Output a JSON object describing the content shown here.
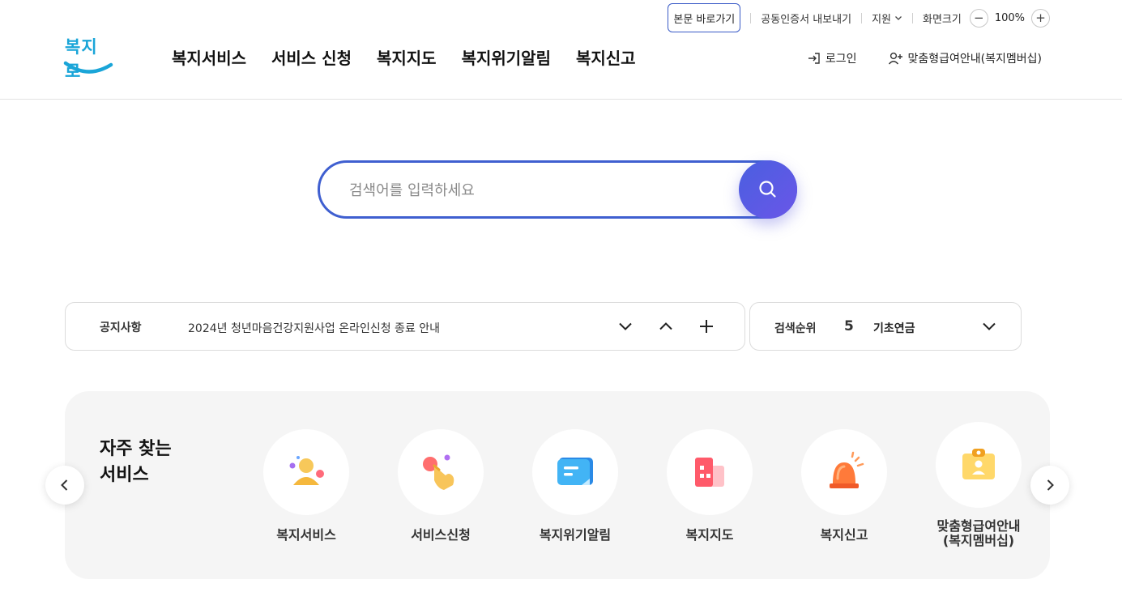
{
  "util": {
    "skip_link": "본문 바로가기",
    "cert_export": "공동인증서 내보내기",
    "support": "지원",
    "zoom_label": "화면크기",
    "zoom_minus": "−",
    "zoom_value": "100%",
    "zoom_plus": "+"
  },
  "logo": {
    "text": "복지로"
  },
  "gnb": {
    "items": [
      {
        "label": "복지서비스"
      },
      {
        "label": "서비스 신청"
      },
      {
        "label": "복지지도"
      },
      {
        "label": "복지위기알림"
      },
      {
        "label": "복지신고"
      }
    ]
  },
  "header": {
    "login": "로그인",
    "membership": "맞춤형급여안내(복지멤버십)"
  },
  "search": {
    "placeholder": "검색어를 입력하세요",
    "value": ""
  },
  "notice": {
    "label": "공지사항",
    "text": "2024년 청년마음건강지원사업 온라인신청 종료 안내"
  },
  "rank": {
    "label": "검색순위",
    "number": "5",
    "term": "기초연금"
  },
  "freq": {
    "title_line1": "자주 찾는",
    "title_line2": "서비스",
    "services": [
      {
        "label": "복지서비스",
        "icon": "person-icon"
      },
      {
        "label": "서비스신청",
        "icon": "pointer-hand-icon"
      },
      {
        "label": "복지위기알림",
        "icon": "message-icon"
      },
      {
        "label": "복지지도",
        "icon": "building-map-icon"
      },
      {
        "label": "복지신고",
        "icon": "siren-icon"
      },
      {
        "label": "맞춤형급여안내\n(복지멤버십)",
        "label_line1": "맞춤형급여안내",
        "label_line2": "(복지멤버십)",
        "icon": "membership-card-icon"
      }
    ]
  },
  "colors": {
    "brand_blue": "#3f5fd0",
    "search_button_start": "#4a5fe0",
    "search_button_end": "#6a56e8",
    "logo_blue": "#1aa5d8",
    "panel_bg": "#f5f5f5"
  }
}
